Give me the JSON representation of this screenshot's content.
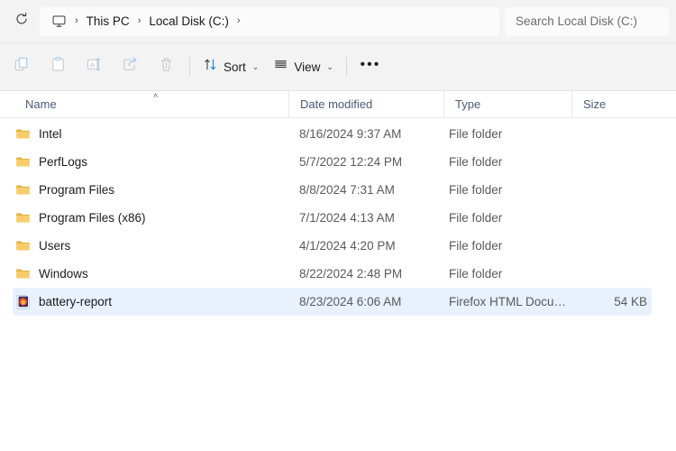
{
  "addressbar": {
    "refresh_icon": "refresh-icon",
    "pc_icon": "this-pc-monitor-icon",
    "crumbs": [
      {
        "label": "This PC"
      },
      {
        "label": "Local Disk (C:)"
      }
    ],
    "separator": "›",
    "search": {
      "placeholder": "Search Local Disk (C:)"
    }
  },
  "toolbar": {
    "buttons": [
      {
        "name": "copy-button",
        "icon": "copy-icon"
      },
      {
        "name": "paste-button",
        "icon": "paste-icon"
      },
      {
        "name": "rename-button",
        "icon": "rename-icon"
      },
      {
        "name": "share-button",
        "icon": "share-icon"
      },
      {
        "name": "delete-button",
        "icon": "delete-trash-icon"
      }
    ],
    "sort_label": "Sort",
    "view_label": "View",
    "overflow_label": "•••",
    "chevron": "⌄"
  },
  "columns": {
    "name": "Name",
    "date_modified": "Date modified",
    "type": "Type",
    "size": "Size",
    "sort_indicator": "˄"
  },
  "files": [
    {
      "name": "Intel",
      "date_modified": "8/16/2024 9:37 AM",
      "type": "File folder",
      "size": "",
      "icon": "folder-icon",
      "selected": false
    },
    {
      "name": "PerfLogs",
      "date_modified": "5/7/2022 12:24 PM",
      "type": "File folder",
      "size": "",
      "icon": "folder-icon",
      "selected": false
    },
    {
      "name": "Program Files",
      "date_modified": "8/8/2024 7:31 AM",
      "type": "File folder",
      "size": "",
      "icon": "folder-icon",
      "selected": false
    },
    {
      "name": "Program Files (x86)",
      "date_modified": "7/1/2024 4:13 AM",
      "type": "File folder",
      "size": "",
      "icon": "folder-icon",
      "selected": false
    },
    {
      "name": "Users",
      "date_modified": "4/1/2024 4:20 PM",
      "type": "File folder",
      "size": "",
      "icon": "folder-icon",
      "selected": false
    },
    {
      "name": "Windows",
      "date_modified": "8/22/2024 2:48 PM",
      "type": "File folder",
      "size": "",
      "icon": "folder-icon",
      "selected": false
    },
    {
      "name": "battery-report",
      "date_modified": "8/23/2024 6:06 AM",
      "type": "Firefox HTML Docum…",
      "size": "54 KB",
      "icon": "firefox-html-document-icon",
      "selected": true
    }
  ],
  "colors": {
    "chrome_background": "#f3f3f3",
    "content_background": "#ffffff",
    "selection": "#e8f1fc",
    "folder_yellow": "#f7cd6b",
    "accent_blue": "#0078d4",
    "header_text": "#4a5a78"
  }
}
